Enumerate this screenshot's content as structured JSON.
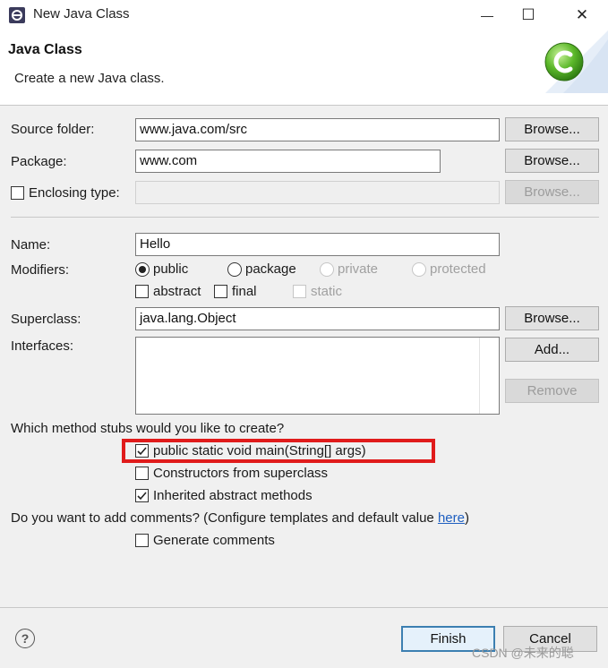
{
  "window": {
    "title": "New Java Class",
    "minimize_glyph": "—",
    "maximize_glyph": "☐",
    "close_glyph": "✕"
  },
  "header": {
    "title": "Java Class",
    "description": "Create a new Java class."
  },
  "form": {
    "source_folder": {
      "label": "Source folder:",
      "value": "www.java.com/src",
      "browse": "Browse..."
    },
    "package": {
      "label": "Package:",
      "value": "www.com",
      "browse": "Browse..."
    },
    "enclosing_type": {
      "label": "Enclosing type:",
      "checked": false,
      "value": "",
      "browse": "Browse..."
    },
    "name": {
      "label": "Name:",
      "value": "Hello"
    },
    "modifiers": {
      "label": "Modifiers:",
      "access": [
        {
          "label": "public",
          "selected": true,
          "enabled": true
        },
        {
          "label": "package",
          "selected": false,
          "enabled": true
        },
        {
          "label": "private",
          "selected": false,
          "enabled": false
        },
        {
          "label": "protected",
          "selected": false,
          "enabled": false
        }
      ],
      "flags": [
        {
          "label": "abstract",
          "checked": false,
          "enabled": true
        },
        {
          "label": "final",
          "checked": false,
          "enabled": true
        },
        {
          "label": "static",
          "checked": false,
          "enabled": false
        }
      ]
    },
    "superclass": {
      "label": "Superclass:",
      "value": "java.lang.Object",
      "browse": "Browse..."
    },
    "interfaces": {
      "label": "Interfaces:",
      "add": "Add...",
      "remove": "Remove"
    },
    "stubs": {
      "question": "Which method stubs would you like to create?",
      "options": [
        {
          "label": "public static void main(String[] args)",
          "checked": true
        },
        {
          "label": "Constructors from superclass",
          "checked": false
        },
        {
          "label": "Inherited abstract methods",
          "checked": true
        }
      ]
    },
    "comments": {
      "question_prefix": "Do you want to add comments? (Configure templates and default value ",
      "link": "here",
      "question_suffix": ")",
      "option": {
        "label": "Generate comments",
        "checked": false
      }
    }
  },
  "footer": {
    "help_glyph": "?",
    "finish": "Finish",
    "cancel": "Cancel"
  },
  "watermark": "CSDN @未来的聪",
  "colors": {
    "highlight": "#e01b1b",
    "link": "#1f5fc0",
    "default_button_border": "#3c7fb1"
  }
}
